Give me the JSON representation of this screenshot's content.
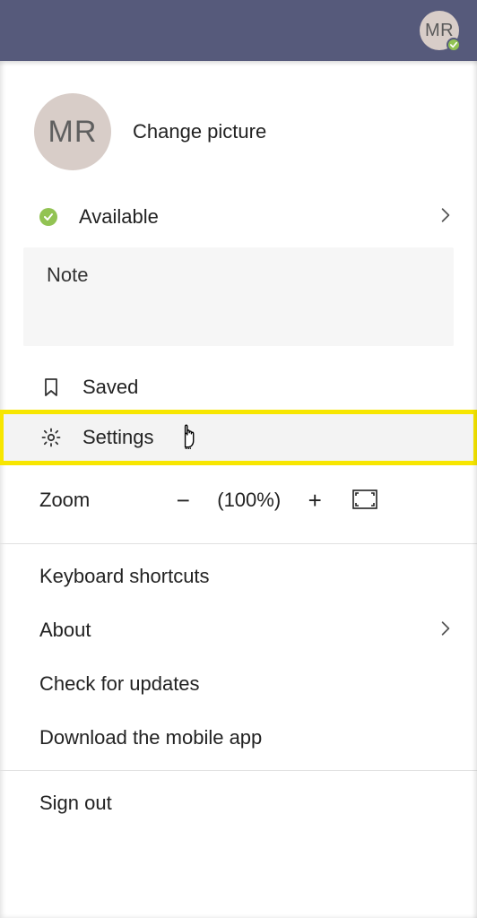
{
  "topbar": {
    "avatar_initials": "MR"
  },
  "profile": {
    "avatar_initials": "MR",
    "change_picture_label": "Change picture"
  },
  "presence": {
    "status_label": "Available"
  },
  "note": {
    "placeholder": "Note",
    "value": ""
  },
  "menu": {
    "saved_label": "Saved",
    "settings_label": "Settings"
  },
  "zoom": {
    "label": "Zoom",
    "percent_display": "(100%)"
  },
  "more": {
    "keyboard_shortcuts_label": "Keyboard shortcuts",
    "about_label": "About",
    "check_updates_label": "Check for updates",
    "download_app_label": "Download the mobile app",
    "sign_out_label": "Sign out"
  }
}
